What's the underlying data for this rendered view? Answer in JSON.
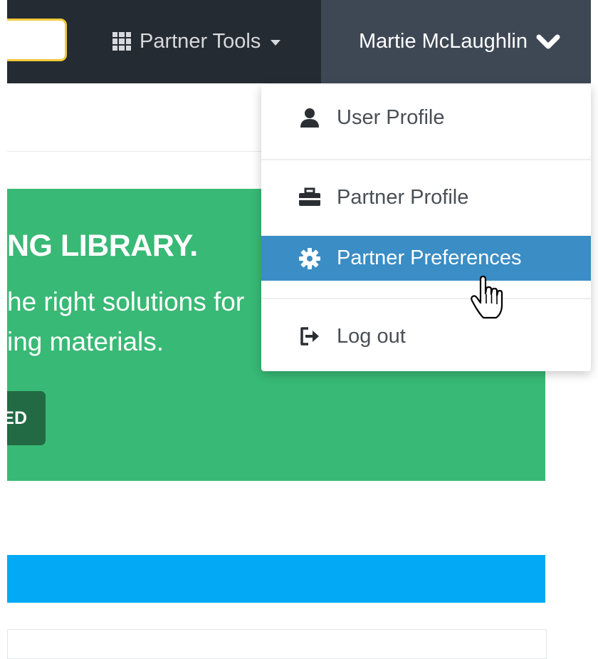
{
  "navbar": {
    "partner_tools_label": "Partner Tools",
    "user_name": "Martie McLaughlin"
  },
  "hero": {
    "title": "NG LIBRARY.",
    "line1": "he right solutions for",
    "line2": "ing materials.",
    "button_label": "ED"
  },
  "dropdown": {
    "items": [
      {
        "label": "User Profile",
        "icon": "user-icon"
      },
      {
        "label": "Partner Profile",
        "icon": "briefcase-icon"
      },
      {
        "label": "Partner Preferences",
        "icon": "gear-icon",
        "active": true
      },
      {
        "label": "Log out",
        "icon": "logout-icon"
      }
    ]
  },
  "colors": {
    "navbar_bg": "#252b33",
    "user_toggle_bg": "#3e4855",
    "search_border": "#f0c93a",
    "hero_bg": "#38b975",
    "hero_button_bg": "#216a43",
    "active_item_bg": "#3a8dc5",
    "blue_bar": "#03a9f4"
  }
}
